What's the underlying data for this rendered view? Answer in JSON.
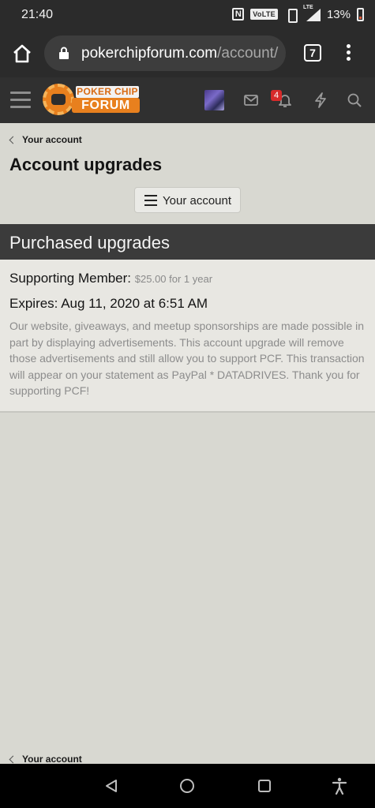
{
  "status_bar": {
    "time": "21:40",
    "network": "VoLTE",
    "lte_label": "LTE",
    "battery": "13%"
  },
  "browser": {
    "url_domain": "pokerchipforum.com",
    "url_path": "/account/",
    "tab_count": "7"
  },
  "site_header": {
    "logo_top": "POKER CHIP",
    "logo_bottom": "FORUM",
    "alerts_badge": "4"
  },
  "breadcrumb": {
    "label": "Your account"
  },
  "page": {
    "title": "Account upgrades",
    "nav_button_label": "Your account"
  },
  "purchased": {
    "heading": "Purchased upgrades",
    "upgrade_title": "Supporting Member:",
    "upgrade_cost": "$25.00 for 1 year",
    "expires": "Expires: Aug 11, 2020 at 6:51 AM",
    "description": "Our website, giveaways, and meetup sponsorships are made possible in part by displaying advertisements. This account upgrade will remove those advertisements and still allow you to support PCF. This transaction will appear on your statement as PayPal * DATADRIVES. Thank you for supporting PCF!"
  },
  "bottom_breadcrumb": {
    "label": "Your account"
  },
  "icons": [
    "home-icon",
    "lock-icon",
    "menu-icon",
    "mail-icon",
    "bell-icon",
    "bolt-icon",
    "search-icon",
    "back-icon",
    "home-nav-icon",
    "recents-icon",
    "accessibility-icon"
  ]
}
